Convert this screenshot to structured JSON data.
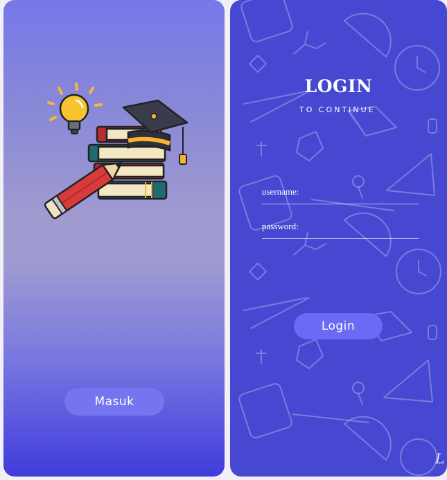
{
  "welcome": {
    "masuk_label": "Masuk",
    "illustration_icon": "education-books-graduation-cap-pencil-lightbulb"
  },
  "login": {
    "title": "LOGIN",
    "subtitle": "TO CONTINUE",
    "username_label": "username:",
    "password_label": "password:",
    "login_label": "Login",
    "background_icon": "school-doodle-pattern"
  },
  "colors": {
    "left_gradient_top": "#7777e9",
    "left_gradient_bottom": "#3f3cdc",
    "right_background": "#4648d2",
    "button": "#7575f0"
  }
}
